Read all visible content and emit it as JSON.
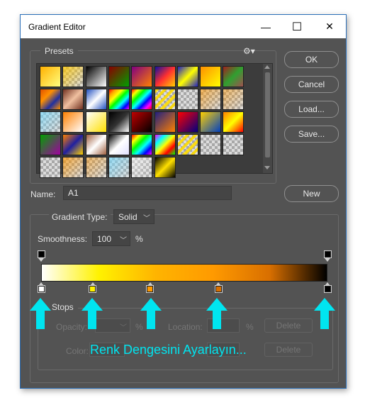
{
  "window": {
    "title": "Gradient Editor",
    "minimize_glyph": "—",
    "maximize_glyph": "☐",
    "close_glyph": "✕"
  },
  "presets": {
    "label": "Presets",
    "gear_glyph": "⚙▾"
  },
  "buttons": {
    "ok": "OK",
    "cancel": "Cancel",
    "load": "Load...",
    "save": "Save...",
    "new": "New"
  },
  "name": {
    "label": "Name:",
    "value": "A1"
  },
  "gradient_type": {
    "label": "Gradient Type:",
    "value": "Solid"
  },
  "smoothness": {
    "label": "Smoothness:",
    "value": "100",
    "unit": "%"
  },
  "gradient": {
    "colors": [
      "#ffffff",
      "#fff200",
      "#ffb400",
      "#ff9a00",
      "#d86f00",
      "#000000"
    ],
    "color_stop_locations": [
      0,
      18,
      38,
      62,
      100
    ],
    "opacity_stop_locations": [
      0,
      100
    ]
  },
  "stops": {
    "label": "Stops",
    "opacity_label": "Opacity:",
    "opacity_unit": "%",
    "location_label": "Location:",
    "location_unit": "%",
    "delete_label": "Delete",
    "color_label": "Color:",
    "color_delete_label": "Delete"
  },
  "annotation": {
    "caption": "Renk Dengesini Ayarlayın...",
    "color": "#00e5f0"
  }
}
